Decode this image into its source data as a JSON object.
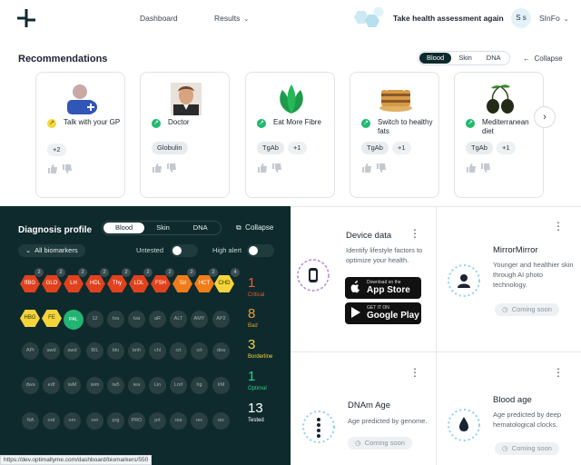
{
  "header": {
    "nav_dashboard": "Dashboard",
    "nav_results": "Results",
    "take_assessment": "Take health assessment again",
    "avatar_initials": "S s",
    "user_name": "SInFo"
  },
  "recommendations": {
    "title": "Recommendations",
    "tabs": [
      "Blood",
      "Skin",
      "DNA"
    ],
    "active_tab": "Blood",
    "collapse": "Collapse",
    "cards": [
      {
        "label": "Talk with your GP",
        "status": "yellow",
        "chips": [
          "+2"
        ]
      },
      {
        "label": "Doctor",
        "status": "green",
        "chips": [
          "Globulin"
        ]
      },
      {
        "label": "Eat More Fibre",
        "status": "green",
        "chips": [
          "TgAb",
          "+1"
        ]
      },
      {
        "label": "Switch to healthy fats",
        "status": "green",
        "chips": [
          "TgAb",
          "+1"
        ]
      },
      {
        "label": "Mediterranean diet",
        "status": "green",
        "chips": [
          "TgAb",
          "+1"
        ]
      }
    ]
  },
  "diagnosis": {
    "title": "Diagnosis profile",
    "tabs": [
      "Blood",
      "Skin",
      "DNA"
    ],
    "active_tab": "Blood",
    "collapse": "Collapse",
    "filter": "All biomarkers",
    "untested_label": "Untested",
    "high_alert_label": "High alert",
    "critical_row": [
      {
        "code": "fIBG",
        "color": "red",
        "badge": "2"
      },
      {
        "code": "GLO",
        "color": "red",
        "badge": "2"
      },
      {
        "code": "LH",
        "color": "red",
        "badge": "2"
      },
      {
        "code": "HDL",
        "color": "red",
        "badge": "2"
      },
      {
        "code": "Thy",
        "color": "red",
        "badge": "2"
      },
      {
        "code": "LDL",
        "color": "red",
        "badge": "2"
      },
      {
        "code": "FSH",
        "color": "red",
        "badge": "2"
      },
      {
        "code": "Tol",
        "color": "orange",
        "badge": "2"
      },
      {
        "code": "HCT",
        "color": "orange",
        "badge": "2"
      },
      {
        "code": "CHD",
        "color": "yellow",
        "badge": "4"
      }
    ],
    "row2": [
      {
        "code": "HBG",
        "type": "yellow"
      },
      {
        "code": "FE",
        "type": "yellow"
      },
      {
        "code": "PAL",
        "type": "green"
      },
      {
        "code": "12",
        "type": "dot"
      },
      {
        "code": "tva",
        "type": "dot"
      },
      {
        "code": "tva",
        "type": "dot"
      },
      {
        "code": "aR",
        "type": "dot"
      },
      {
        "code": "ALT",
        "type": "dot"
      },
      {
        "code": "AMY",
        "type": "dot"
      },
      {
        "code": "AP2",
        "type": "dot"
      }
    ],
    "row3": [
      "APr",
      "awd",
      "awd",
      "BIL",
      "blo",
      "bnh",
      "chl",
      "crt",
      "crt",
      "dea"
    ],
    "row4": [
      "dwa",
      "edf",
      "iwM",
      "iwm",
      "iw5",
      "iea",
      "Lin",
      "Lmf",
      "lrg",
      "lrM"
    ],
    "row5": [
      "NA",
      "ord",
      "orn",
      "orn",
      "prg",
      "PRO",
      "prt",
      "rea",
      "rec",
      "rec"
    ],
    "stats": [
      {
        "value": "1",
        "label": "Critical",
        "color": "red"
      },
      {
        "value": "8",
        "label": "Bad",
        "color": "orange"
      },
      {
        "value": "3",
        "label": "Borderline",
        "color": "yellow"
      },
      {
        "value": "1",
        "label": "Optimal",
        "color": "green"
      },
      {
        "value": "13",
        "label": "Tested",
        "color": "white"
      }
    ]
  },
  "device_data": {
    "title": "Device data",
    "desc": "Identify lifestyle factors to optimize your health.",
    "appstore_small": "Download on the",
    "appstore_big": "App Store",
    "googleplay_small": "GET IT ON",
    "googleplay_big": "Google Play"
  },
  "mirrormirror": {
    "title": "MirrorMirror",
    "desc": "Younger and healthier skin through AI photo technology.",
    "coming_soon": "Coming soon"
  },
  "dnam_age": {
    "title": "DNAm Age",
    "desc": "Age predicted by genome.",
    "coming_soon": "Coming soon"
  },
  "blood_age": {
    "title": "Blood age",
    "desc": "Age predicted by deep hematological clocks.",
    "coming_soon": "Coming soon"
  },
  "status_bar": {
    "url": "https://dev.optimallyme.com/dashboard/biomarkers/550"
  }
}
